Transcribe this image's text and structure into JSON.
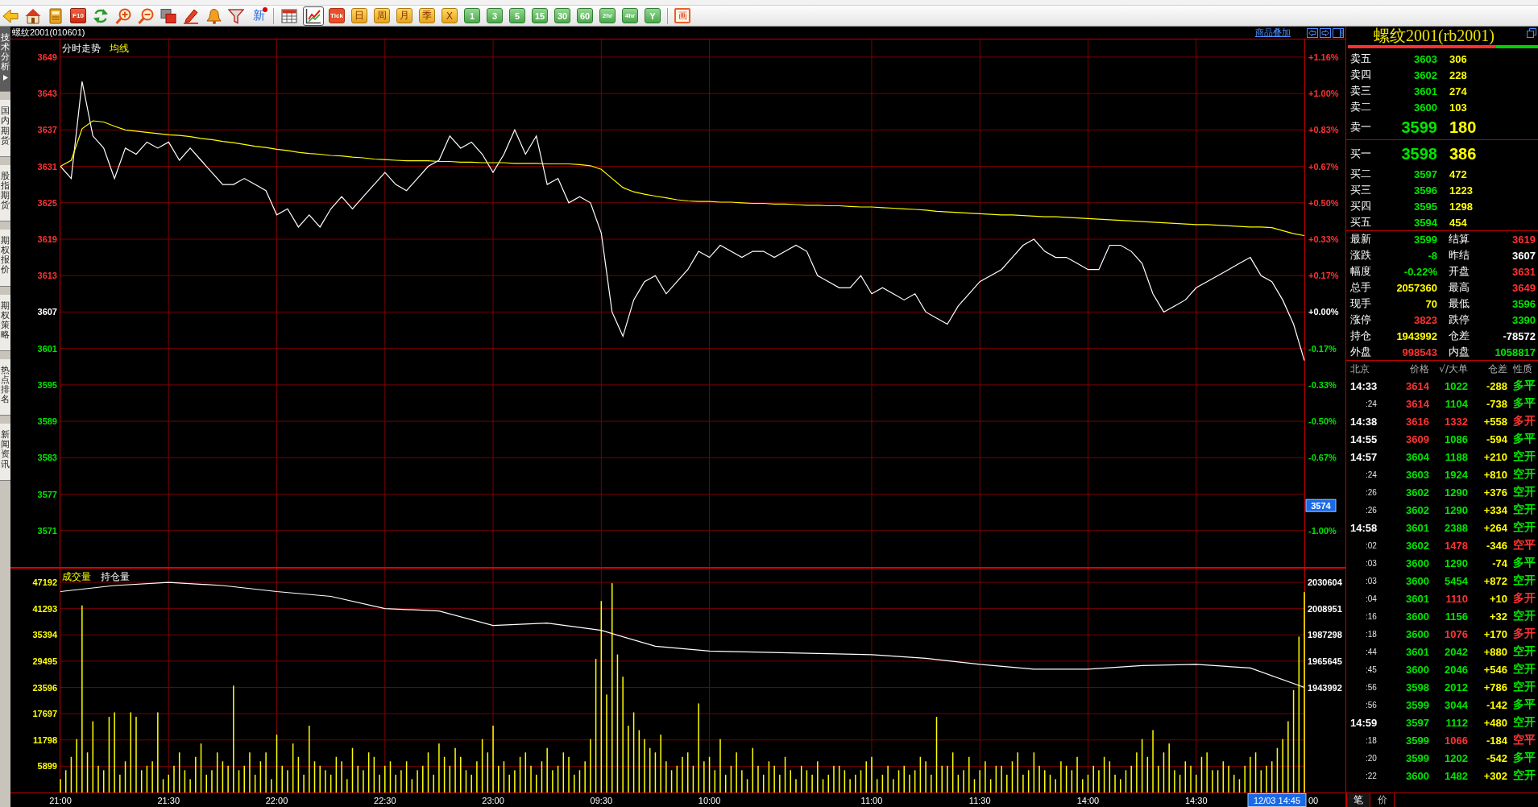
{
  "toolbar": {
    "f10_label": "F10",
    "news_button": {
      "label": "新",
      "unread": true
    },
    "view_buttons": [
      {
        "selected": false
      },
      {
        "selected": true
      }
    ],
    "period_buttons": [
      {
        "label": "Tick",
        "kind": "tick"
      },
      {
        "label": "日",
        "kind": "calendar"
      },
      {
        "label": "周",
        "kind": "calendar"
      },
      {
        "label": "月",
        "kind": "calendar"
      },
      {
        "label": "季",
        "kind": "calendar"
      },
      {
        "label": "X",
        "kind": "calendar"
      },
      {
        "label": "1",
        "kind": "minute"
      },
      {
        "label": "3",
        "kind": "minute"
      },
      {
        "label": "5",
        "kind": "minute"
      },
      {
        "label": "15",
        "kind": "minute"
      },
      {
        "label": "30",
        "kind": "minute"
      },
      {
        "label": "60",
        "kind": "minute"
      },
      {
        "label": "2hr",
        "kind": "minute"
      },
      {
        "label": "4hr",
        "kind": "minute"
      },
      {
        "label": "Y",
        "kind": "minute"
      }
    ],
    "draw_button": "画"
  },
  "sidebar_tabs": [
    {
      "label": "技术分析",
      "selected": true
    },
    {
      "label": "国内期货",
      "selected": false
    },
    {
      "label": "股指期货",
      "selected": false
    },
    {
      "label": "期权报价",
      "selected": false
    },
    {
      "label": "期权策略",
      "selected": false
    },
    {
      "label": "热点排名",
      "selected": false
    },
    {
      "label": "新闻资讯",
      "selected": false
    }
  ],
  "chart_header": {
    "title": "螺纹2001(010601)",
    "overlay_link": "商品叠加"
  },
  "price_chart": {
    "chart_data": {
      "type": "line",
      "grid": true,
      "categories": [
        null,
        null,
        null,
        null,
        null,
        null,
        null,
        null,
        null,
        null,
        null,
        null,
        null,
        null,
        null,
        null,
        null,
        null,
        null,
        null,
        null,
        null,
        null,
        null,
        null,
        null,
        null,
        null,
        null,
        null,
        null,
        null,
        null,
        null,
        null,
        null,
        null,
        null,
        null,
        null,
        null,
        null,
        null,
        null,
        null,
        null,
        null,
        null,
        null,
        null,
        null,
        null,
        null,
        null,
        null,
        null,
        null,
        null,
        null,
        null,
        null,
        null,
        null,
        null,
        null,
        null,
        null,
        null,
        null,
        null,
        null,
        null,
        null,
        null,
        null,
        null,
        null,
        null,
        null,
        null,
        null,
        null,
        null,
        null,
        null,
        null,
        null,
        null,
        null,
        null,
        null,
        null,
        null,
        null,
        null,
        null,
        null,
        null,
        null,
        null,
        null,
        null,
        null,
        null,
        null,
        null,
        null,
        null,
        null,
        null,
        null,
        null,
        null,
        null,
        null,
        null
      ],
      "series": [
        {
          "name": "分时走势",
          "color": "#ffffff",
          "values": [
            3631,
            3629,
            3645,
            3636,
            3634,
            3629,
            3634,
            3633,
            3635,
            3634,
            3635,
            3632,
            3634,
            3632,
            3630,
            3628,
            3628,
            3629,
            3628,
            3627,
            3623,
            3624,
            3621,
            3623,
            3621,
            3624,
            3626,
            3624,
            3626,
            3628,
            3630,
            3628,
            3627,
            3629,
            3631,
            3632,
            3636,
            3634,
            3635,
            3633,
            3630,
            3633,
            3637,
            3633,
            3636,
            3628,
            3629,
            3625,
            3626,
            3625,
            3620,
            3607,
            3603,
            3609,
            3612,
            3613,
            3610,
            3612,
            3614,
            3617,
            3616,
            3618,
            3617,
            3616,
            3617,
            3617,
            3616,
            3617,
            3618,
            3617,
            3613,
            3612,
            3611,
            3611,
            3613,
            3610,
            3611,
            3610,
            3609,
            3610,
            3607,
            3606,
            3605,
            3608,
            3610,
            3612,
            3613,
            3614,
            3616,
            3618,
            3619,
            3617,
            3616,
            3616,
            3615,
            3614,
            3614,
            3618,
            3618,
            3617,
            3615,
            3610,
            3607,
            3608,
            3609,
            3611,
            3612,
            3613,
            3614,
            3615,
            3616,
            3613,
            3612,
            3609,
            3605,
            3599
          ]
        },
        {
          "name": "均线",
          "color": "#ffff00",
          "values": [
            3631,
            3632,
            3637.2,
            3638.5,
            3638.3,
            3637.6,
            3637,
            3636.8,
            3636.6,
            3636.4,
            3636.2,
            3636.1,
            3635.9,
            3635.6,
            3635.4,
            3635.1,
            3634.9,
            3634.6,
            3634.3,
            3634.1,
            3633.8,
            3633.6,
            3633.3,
            3633.1,
            3633,
            3632.8,
            3632.7,
            3632.5,
            3632.4,
            3632.2,
            3632.1,
            3632,
            3631.9,
            3631.9,
            3631.9,
            3631.8,
            3631.8,
            3631.7,
            3631.7,
            3631.6,
            3631.6,
            3631.6,
            3631.5,
            3631.5,
            3631.5,
            3631.4,
            3631.4,
            3631.4,
            3631.3,
            3631.1,
            3630.5,
            3629,
            3627.5,
            3626.8,
            3626.4,
            3626.1,
            3625.8,
            3625.5,
            3625.3,
            3625.2,
            3625.2,
            3625.1,
            3625.1,
            3625,
            3624.9,
            3624.9,
            3624.8,
            3624.8,
            3624.7,
            3624.6,
            3624.6,
            3624.5,
            3624.5,
            3624.4,
            3624.3,
            3624.3,
            3624.2,
            3624.1,
            3624,
            3623.9,
            3623.8,
            3623.6,
            3623.5,
            3623.4,
            3623.3,
            3623.2,
            3623.1,
            3623,
            3623,
            3622.9,
            3622.8,
            3622.7,
            3622.7,
            3622.6,
            3622.5,
            3622.4,
            3622.3,
            3622.2,
            3622.1,
            3622,
            3621.9,
            3621.8,
            3621.7,
            3621.6,
            3621.5,
            3621.4,
            3621.4,
            3621.3,
            3621.2,
            3621.1,
            3621,
            3621,
            3620.9,
            3620.4,
            3619.9,
            3619.6
          ]
        }
      ],
      "ylim": [
        3565,
        3651.9
      ],
      "yticks": [
        3649,
        3643,
        3637,
        3631,
        3625,
        3619,
        3613,
        3607,
        3601,
        3595,
        3589,
        3583,
        3577,
        3571
      ]
    },
    "cursor_label": "3574",
    "percent_axis": [
      {
        "label": "+1.16%",
        "color": "#ff3333"
      },
      {
        "label": "+1.00%",
        "color": "#ff3333"
      },
      {
        "label": "+0.83%",
        "color": "#ff3333"
      },
      {
        "label": "+0.67%",
        "color": "#ff3333"
      },
      {
        "label": "+0.50%",
        "color": "#ff3333"
      },
      {
        "label": "+0.33%",
        "color": "#ff3333"
      },
      {
        "label": "+0.17%",
        "color": "#ff3333"
      },
      {
        "label": "+0.00%",
        "color": "#ffffff"
      },
      {
        "label": "-0.17%",
        "color": "#00e600"
      },
      {
        "label": "-0.33%",
        "color": "#00e600"
      },
      {
        "label": "-0.50%",
        "color": "#00e600"
      },
      {
        "label": "-0.67%",
        "color": "#00e600"
      },
      {
        "color": "#00e600"
      },
      {
        "label": "-1.00%",
        "color": "#00e600"
      }
    ]
  },
  "volume_panel": {
    "volume_chart": {
      "chart_data": {
        "type": "bar",
        "grid": true,
        "categories": [
          "21:00",
          null,
          null,
          null,
          null,
          null,
          null,
          null,
          null,
          null,
          null,
          null,
          null,
          null,
          null,
          null,
          null,
          null,
          null,
          null,
          "21:30",
          null,
          null,
          null,
          null,
          null,
          null,
          null,
          null,
          null,
          null,
          null,
          null,
          null,
          null,
          null,
          null,
          null,
          null,
          null,
          "22:00",
          null,
          null,
          null,
          null,
          null,
          null,
          null,
          null,
          null,
          null,
          null,
          null,
          null,
          null,
          null,
          null,
          null,
          null,
          null,
          "22:30",
          null,
          null,
          null,
          null,
          null,
          null,
          null,
          null,
          null,
          null,
          null,
          null,
          null,
          null,
          null,
          null,
          null,
          null,
          null,
          "23:00",
          null,
          null,
          null,
          null,
          null,
          null,
          null,
          null,
          null,
          null,
          null,
          null,
          null,
          null,
          null,
          null,
          null,
          null,
          null,
          "09:30",
          null,
          null,
          null,
          null,
          null,
          null,
          null,
          null,
          null,
          null,
          null,
          null,
          null,
          null,
          null,
          null,
          null,
          null,
          null,
          "10:00",
          null,
          null,
          null,
          null,
          null,
          null,
          null,
          null,
          null,
          null,
          null,
          null,
          null,
          null,
          null,
          null,
          null,
          null,
          null,
          null,
          null,
          null,
          null,
          null,
          null,
          null,
          null,
          null,
          null,
          "11:00",
          null,
          null,
          null,
          null,
          null,
          null,
          null,
          null,
          null,
          null,
          null,
          null,
          null,
          null,
          null,
          null,
          null,
          null,
          null,
          "11:30",
          null,
          null,
          null,
          null,
          null,
          null,
          null,
          null,
          null,
          null,
          null,
          null,
          null,
          null,
          null,
          null,
          null,
          null,
          null,
          "14:00",
          null,
          null,
          null,
          null,
          null,
          null,
          null,
          null,
          null,
          null,
          null,
          null,
          null,
          null,
          null,
          null,
          null,
          null,
          null,
          "14:30",
          null,
          null,
          null,
          null,
          null,
          null,
          null,
          null,
          null,
          null,
          null,
          null,
          null,
          null,
          null,
          null,
          null,
          null,
          null,
          null
        ],
        "series": [
          {
            "name": "成交量",
            "color": "#ffff00",
            "values": [
              3000,
              5000,
              8000,
              12000,
              42000,
              9000,
              16000,
              6000,
              5000,
              17000,
              18000,
              4000,
              7000,
              18000,
              17000,
              5000,
              6000,
              7000,
              18000,
              3000,
              4000,
              6000,
              9000,
              5000,
              3000,
              8000,
              11000,
              4000,
              5000,
              9000,
              7000,
              6000,
              24000,
              5000,
              6000,
              9000,
              4000,
              7000,
              9000,
              3000,
              13000,
              6000,
              5000,
              11000,
              8000,
              4000,
              15000,
              7000,
              6000,
              5000,
              4000,
              8000,
              7000,
              3000,
              10000,
              6000,
              5000,
              9000,
              8000,
              4000,
              6000,
              7000,
              4000,
              5000,
              7000,
              3000,
              5000,
              6000,
              9000,
              4000,
              11000,
              8000,
              6000,
              10000,
              8000,
              5000,
              4000,
              7000,
              12000,
              9000,
              15000,
              6000,
              7000,
              4000,
              5000,
              8000,
              9000,
              6000,
              4000,
              7000,
              10000,
              5000,
              6000,
              9000,
              8000,
              4000,
              5000,
              7000,
              12000,
              30000,
              43000,
              22000,
              47000,
              31000,
              26000,
              15000,
              18000,
              14000,
              12000,
              10000,
              9000,
              13000,
              7000,
              5000,
              6000,
              8000,
              9000,
              6000,
              20000,
              7000,
              8000,
              5000,
              12000,
              4000,
              6000,
              9000,
              5000,
              3000,
              10000,
              6000,
              4000,
              7000,
              6000,
              4000,
              8000,
              5000,
              3000,
              6000,
              5000,
              4000,
              7000,
              3000,
              4000,
              6000,
              6000,
              5000,
              3000,
              4000,
              5000,
              7000,
              8000,
              3000,
              4000,
              6000,
              3000,
              5000,
              6000,
              4000,
              5000,
              8000,
              7000,
              4000,
              17000,
              6000,
              6000,
              9000,
              4000,
              5000,
              8000,
              3000,
              5000,
              7000,
              3000,
              6000,
              6000,
              4000,
              7000,
              9000,
              4000,
              5000,
              9000,
              6000,
              5000,
              4000,
              3000,
              7000,
              6000,
              5000,
              8000,
              3000,
              4000,
              6000,
              5000,
              8000,
              7000,
              4000,
              3000,
              5000,
              6000,
              9000,
              12000,
              8000,
              14000,
              6000,
              9000,
              11000,
              5000,
              4000,
              7000,
              6000,
              4000,
              8000,
              9000,
              5000,
              5000,
              7000,
              6000,
              4000,
              3000,
              6000,
              8000,
              9000,
              5000,
              6000,
              7000,
              10000,
              12000,
              16000,
              23000,
              35000,
              45000
            ]
          }
        ],
        "ylim": [
          0,
          50460
        ],
        "yticks": [
          47192,
          41293,
          35394,
          29495,
          23596,
          17697,
          11798,
          5899
        ]
      },
      "axis_tail": "00",
      "cursor_time": "12/03 14:45"
    },
    "open_interest_chart": {
      "chart_data": {
        "type": "line",
        "categories": [
          null,
          null,
          null,
          null,
          null,
          null,
          null,
          null,
          null,
          null,
          null,
          null,
          null,
          null,
          null,
          null,
          null,
          null,
          null,
          null,
          null,
          null,
          null,
          null
        ],
        "series": [
          {
            "name": "持仓量",
            "color": "#ffffff",
            "values": [
              2023000,
              2028000,
              2030604,
              2028000,
              2023000,
              2019000,
              2009000,
              2007000,
              1995000,
              1997000,
              1991000,
              1978000,
              1974000,
              1973000,
              1972000,
              1971000,
              1968000,
              1963000,
              1959000,
              1959000,
              1962000,
              1963000,
              1960000,
              1944000
            ]
          }
        ],
        "ylim": [
          1943992,
          2030604
        ],
        "yticks": [
          2030604,
          2008951,
          1987298,
          1965645,
          1943992
        ]
      }
    }
  },
  "quote_panel": {
    "title": "螺纹2001(rb2001)",
    "ratio_bar": {
      "level": 0.78
    },
    "asks": [
      {
        "label": "卖五",
        "price": "3603",
        "volume": "306",
        "kind": "level"
      },
      {
        "label": "卖四",
        "price": "3602",
        "volume": "228",
        "kind": "level"
      },
      {
        "label": "卖三",
        "price": "3601",
        "volume": "274",
        "kind": "level"
      },
      {
        "label": "卖二",
        "price": "3600",
        "volume": "103",
        "kind": "level"
      },
      {
        "label": "卖一",
        "price": "3599",
        "volume": "180",
        "kind": "best"
      }
    ],
    "bids": [
      {
        "label": "买一",
        "price": "3598",
        "volume": "386",
        "kind": "best"
      },
      {
        "label": "买二",
        "price": "3597",
        "volume": "472",
        "kind": "level"
      },
      {
        "label": "买三",
        "price": "3596",
        "volume": "1223",
        "kind": "level"
      },
      {
        "label": "买四",
        "price": "3595",
        "volume": "1298",
        "kind": "level"
      },
      {
        "label": "买五",
        "price": "3594",
        "volume": "454",
        "kind": "level"
      }
    ],
    "stats": [
      {
        "label": "最新",
        "value": {
          "text": "3599",
          "color": "#00e600"
        }
      },
      {
        "label": "结算",
        "value": {
          "text": "3619",
          "color": "#ff3333"
        }
      },
      {
        "label": "涨跌",
        "value": {
          "text": "-8",
          "color": "#00e600"
        }
      },
      {
        "label": "昨结",
        "value": {
          "text": "3607",
          "color": "#ffffff"
        }
      },
      {
        "label": "幅度",
        "value": {
          "text": "-0.22%",
          "color": "#00e600"
        }
      },
      {
        "label": "开盘",
        "value": {
          "text": "3631",
          "color": "#ff3333"
        }
      },
      {
        "label": "总手",
        "value": {
          "text": "2057360",
          "color": "#ffff00"
        }
      },
      {
        "label": "最高",
        "value": {
          "text": "3649",
          "color": "#ff3333"
        }
      },
      {
        "label": "现手",
        "value": {
          "text": "70",
          "color": "#ffff00"
        }
      },
      {
        "label": "最低",
        "value": {
          "text": "3596",
          "color": "#00e600"
        }
      },
      {
        "label": "涨停",
        "value": {
          "text": "3823",
          "color": "#ff3333"
        }
      },
      {
        "label": "跌停",
        "value": {
          "text": "3390",
          "color": "#00e600"
        }
      },
      {
        "label": "持仓",
        "value": {
          "text": "1943992",
          "color": "#ffff00"
        }
      },
      {
        "label": "仓差",
        "value": {
          "text": "-78572",
          "color": "#ffffff"
        }
      },
      {
        "label": "外盘",
        "value": {
          "text": "998543",
          "color": "#ff3333"
        }
      },
      {
        "label": "内盘",
        "value": {
          "text": "1058817",
          "color": "#00e600"
        }
      }
    ],
    "trades": {
      "columns": [
        "北京",
        "价格",
        "√/大单",
        "仓差",
        "性质"
      ],
      "rows": [
        {
          "time": "14:33",
          "kind": "minute",
          "price": {
            "text": "3614",
            "color": "#ff3333"
          },
          "volume": {
            "text": "1022",
            "color": "#00e600"
          },
          "oi_change": "-288",
          "nature": {
            "text": "多平",
            "color": "#00e600"
          }
        },
        {
          "time": ":24",
          "kind": "second",
          "price": {
            "text": "3614",
            "color": "#ff3333"
          },
          "volume": {
            "text": "1104",
            "color": "#00e600"
          },
          "oi_change": "-738",
          "nature": {
            "text": "多平",
            "color": "#00e600"
          }
        },
        {
          "time": "14:38",
          "kind": "minute",
          "price": {
            "text": "3616",
            "color": "#ff3333"
          },
          "volume": {
            "text": "1332",
            "color": "#ff3333"
          },
          "oi_change": "+558",
          "nature": {
            "text": "多开",
            "color": "#ff3333"
          }
        },
        {
          "time": "14:55",
          "kind": "minute",
          "price": {
            "text": "3609",
            "color": "#ff3333"
          },
          "volume": {
            "text": "1086",
            "color": "#00e600"
          },
          "oi_change": "-594",
          "nature": {
            "text": "多平",
            "color": "#00e600"
          }
        },
        {
          "time": "14:57",
          "kind": "minute",
          "price": {
            "text": "3604",
            "color": "#00e600"
          },
          "volume": {
            "text": "1188",
            "color": "#00e600"
          },
          "oi_change": "+210",
          "nature": {
            "text": "空开",
            "color": "#00e600"
          }
        },
        {
          "time": ":24",
          "kind": "second",
          "price": {
            "text": "3603",
            "color": "#00e600"
          },
          "volume": {
            "text": "1924",
            "color": "#00e600"
          },
          "oi_change": "+810",
          "nature": {
            "text": "空开",
            "color": "#00e600"
          }
        },
        {
          "time": ":26",
          "kind": "second",
          "price": {
            "text": "3602",
            "color": "#00e600"
          },
          "volume": {
            "text": "1290",
            "color": "#00e600"
          },
          "oi_change": "+376",
          "nature": {
            "text": "空开",
            "color": "#00e600"
          }
        },
        {
          "time": ":26",
          "kind": "second",
          "price": {
            "text": "3602",
            "color": "#00e600"
          },
          "volume": {
            "text": "1290",
            "color": "#00e600"
          },
          "oi_change": "+334",
          "nature": {
            "text": "空开",
            "color": "#00e600"
          }
        },
        {
          "time": "14:58",
          "kind": "minute",
          "price": {
            "text": "3601",
            "color": "#00e600"
          },
          "volume": {
            "text": "2388",
            "color": "#00e600"
          },
          "oi_change": "+264",
          "nature": {
            "text": "空开",
            "color": "#00e600"
          }
        },
        {
          "time": ":02",
          "kind": "second",
          "price": {
            "text": "3602",
            "color": "#00e600"
          },
          "volume": {
            "text": "1478",
            "color": "#ff3333"
          },
          "oi_change": "-346",
          "nature": {
            "text": "空平",
            "color": "#ff3333"
          }
        },
        {
          "time": ":03",
          "kind": "second",
          "price": {
            "text": "3600",
            "color": "#00e600"
          },
          "volume": {
            "text": "1290",
            "color": "#00e600"
          },
          "oi_change": "-74",
          "nature": {
            "text": "多平",
            "color": "#00e600"
          }
        },
        {
          "time": ":03",
          "kind": "second",
          "price": {
            "text": "3600",
            "color": "#00e600"
          },
          "volume": {
            "text": "5454",
            "color": "#00e600"
          },
          "oi_change": "+872",
          "nature": {
            "text": "空开",
            "color": "#00e600"
          }
        },
        {
          "time": ":04",
          "kind": "second",
          "price": {
            "text": "3601",
            "color": "#00e600"
          },
          "volume": {
            "text": "1110",
            "color": "#ff3333"
          },
          "oi_change": "+10",
          "nature": {
            "text": "多开",
            "color": "#ff3333"
          }
        },
        {
          "time": ":16",
          "kind": "second",
          "price": {
            "text": "3600",
            "color": "#00e600"
          },
          "volume": {
            "text": "1156",
            "color": "#00e600"
          },
          "oi_change": "+32",
          "nature": {
            "text": "空开",
            "color": "#00e600"
          }
        },
        {
          "time": ":18",
          "kind": "second",
          "price": {
            "text": "3600",
            "color": "#00e600"
          },
          "volume": {
            "text": "1076",
            "color": "#ff3333"
          },
          "oi_change": "+170",
          "nature": {
            "text": "多开",
            "color": "#ff3333"
          }
        },
        {
          "time": ":44",
          "kind": "second",
          "price": {
            "text": "3601",
            "color": "#00e600"
          },
          "volume": {
            "text": "2042",
            "color": "#00e600"
          },
          "oi_change": "+880",
          "nature": {
            "text": "空开",
            "color": "#00e600"
          }
        },
        {
          "time": ":45",
          "kind": "second",
          "price": {
            "text": "3600",
            "color": "#00e600"
          },
          "volume": {
            "text": "2046",
            "color": "#00e600"
          },
          "oi_change": "+546",
          "nature": {
            "text": "空开",
            "color": "#00e600"
          }
        },
        {
          "time": ":56",
          "kind": "second",
          "price": {
            "text": "3598",
            "color": "#00e600"
          },
          "volume": {
            "text": "2012",
            "color": "#00e600"
          },
          "oi_change": "+786",
          "nature": {
            "text": "空开",
            "color": "#00e600"
          }
        },
        {
          "time": ":56",
          "kind": "second",
          "price": {
            "text": "3599",
            "color": "#00e600"
          },
          "volume": {
            "text": "3044",
            "color": "#00e600"
          },
          "oi_change": "-142",
          "nature": {
            "text": "多平",
            "color": "#00e600"
          }
        },
        {
          "time": "14:59",
          "kind": "minute",
          "price": {
            "text": "3597",
            "color": "#00e600"
          },
          "volume": {
            "text": "1112",
            "color": "#00e600"
          },
          "oi_change": "+480",
          "nature": {
            "text": "空开",
            "color": "#00e600"
          }
        },
        {
          "time": ":18",
          "kind": "second",
          "price": {
            "text": "3599",
            "color": "#00e600"
          },
          "volume": {
            "text": "1066",
            "color": "#ff3333"
          },
          "oi_change": "-184",
          "nature": {
            "text": "空平",
            "color": "#ff3333"
          }
        },
        {
          "time": ":20",
          "kind": "second",
          "price": {
            "text": "3599",
            "color": "#00e600"
          },
          "volume": {
            "text": "1202",
            "color": "#00e600"
          },
          "oi_change": "-542",
          "nature": {
            "text": "多平",
            "color": "#00e600"
          }
        },
        {
          "time": ":22",
          "kind": "second",
          "price": {
            "text": "3600",
            "color": "#00e600"
          },
          "volume": {
            "text": "1482",
            "color": "#00e600"
          },
          "oi_change": "+302",
          "nature": {
            "text": "空开",
            "color": "#00e600"
          }
        }
      ]
    },
    "tabs": [
      {
        "label": "笔",
        "selected": true
      },
      {
        "label": "价",
        "selected": false
      }
    ]
  }
}
